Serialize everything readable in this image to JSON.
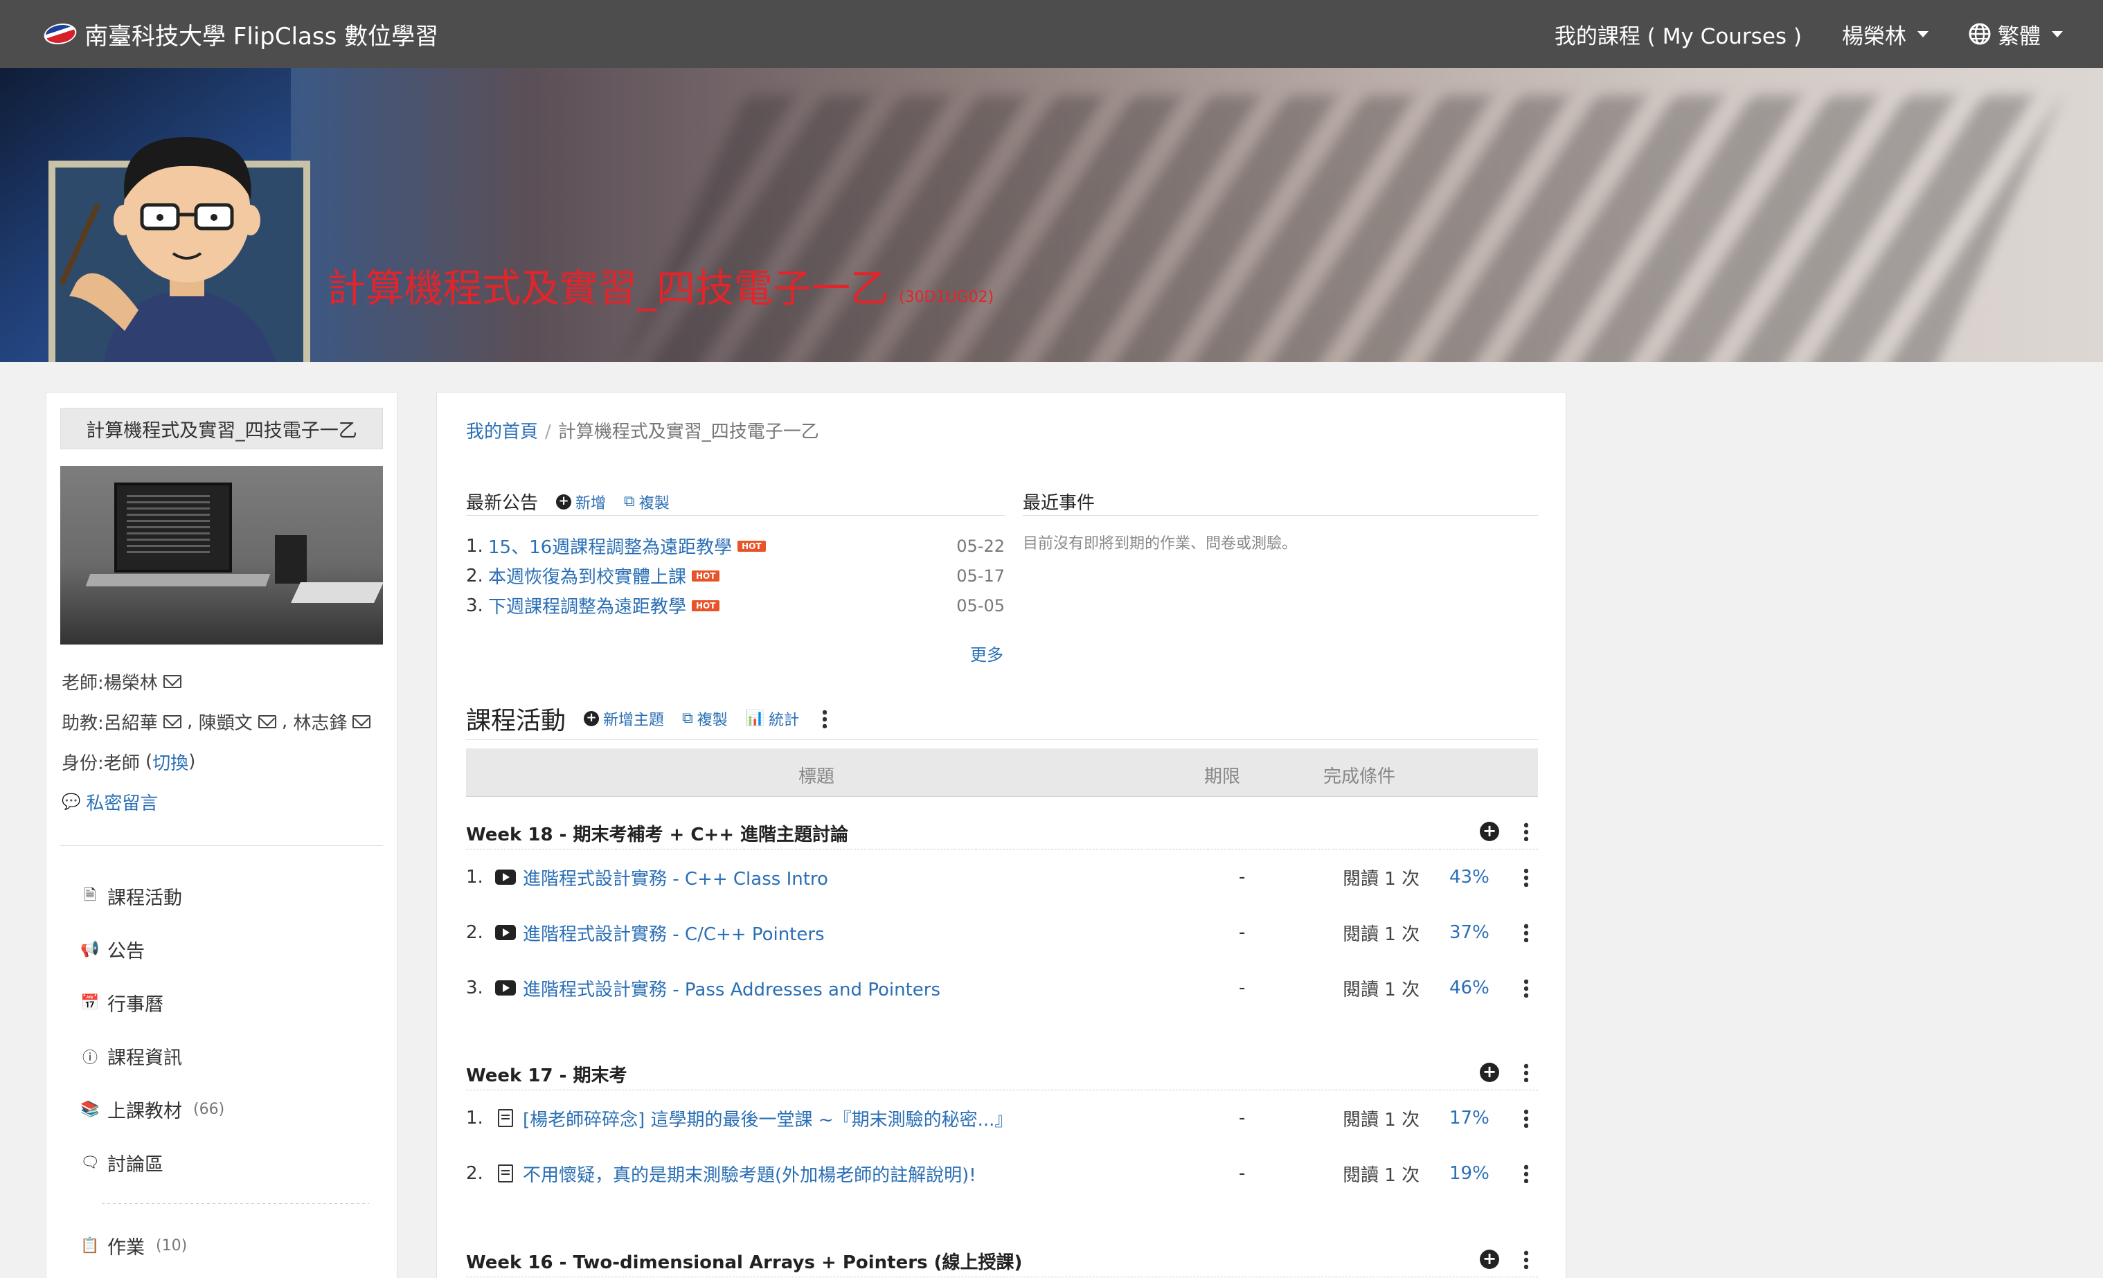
{
  "navbar": {
    "brand": "南臺科技大學 FlipClass 數位學習",
    "my_courses": "我的課程 ( My Courses )",
    "user": "楊榮林",
    "language": "繁體"
  },
  "banner": {
    "course_title": "計算機程式及實習_四技電子一乙",
    "course_code": "(30D1UG02)"
  },
  "sidebar": {
    "course_name": "計算機程式及實習_四技電子一乙",
    "teacher_label": "老師: ",
    "teacher_name": "楊榮林",
    "ta_label": "助教: ",
    "tas": [
      "呂紹華",
      "陳顗文",
      "林志鋒"
    ],
    "role_label": "身份: ",
    "role": "老師",
    "switch_label": "切換",
    "private_message": "私密留言",
    "menu": [
      {
        "label": "課程活動",
        "count": "",
        "icon": "file-icon"
      },
      {
        "label": "公告",
        "count": "",
        "icon": "megaphone-icon"
      },
      {
        "label": "行事曆",
        "count": "",
        "icon": "calendar-icon"
      },
      {
        "label": "課程資訊",
        "count": "",
        "icon": "info-icon"
      },
      {
        "label": "上課教材",
        "count": "(66)",
        "icon": "books-icon"
      },
      {
        "label": "討論區",
        "count": "",
        "icon": "chat-icon"
      },
      {
        "label": "作業",
        "count": "(10)",
        "icon": "clipboard-icon"
      }
    ]
  },
  "breadcrumb": {
    "home": "我的首頁",
    "current": "計算機程式及實習_四技電子一乙"
  },
  "announcements": {
    "title": "最新公告",
    "add": "新增",
    "copy": "複製",
    "items": [
      {
        "num": "1.",
        "text": "15、16週課程調整為遠距教學",
        "badge": "HOT",
        "date": "05-22"
      },
      {
        "num": "2.",
        "text": "本週恢復為到校實體上課",
        "badge": "HOT",
        "date": "05-17"
      },
      {
        "num": "3.",
        "text": "下週課程調整為遠距教學",
        "badge": "HOT",
        "date": "05-05"
      }
    ],
    "more": "更多"
  },
  "events": {
    "title": "最近事件",
    "empty": "目前沒有即將到期的作業、問卷或測驗。"
  },
  "activities": {
    "title": "課程活動",
    "add_topic": "新增主題",
    "copy": "複製",
    "stats": "統計",
    "columns": {
      "title": "標題",
      "deadline": "期限",
      "completion": "完成條件"
    },
    "topics": [
      {
        "title": "Week 18 - 期末考補考 + C++ 進階主題討論",
        "items": [
          {
            "num": "1.",
            "type": "video",
            "text": "進階程式設計實務 - C++ Class Intro",
            "deadline": "-",
            "cond": "閱讀 1 次",
            "pct": "43%"
          },
          {
            "num": "2.",
            "type": "video",
            "text": "進階程式設計實務 - C/C++ Pointers",
            "deadline": "-",
            "cond": "閱讀 1 次",
            "pct": "37%"
          },
          {
            "num": "3.",
            "type": "video",
            "text": "進階程式設計實務 - Pass Addresses and Pointers",
            "deadline": "-",
            "cond": "閱讀 1 次",
            "pct": "46%"
          }
        ]
      },
      {
        "title": "Week 17 - 期末考",
        "items": [
          {
            "num": "1.",
            "type": "doc",
            "text": "[楊老師碎碎念] 這學期的最後一堂課 ~『期末測驗的秘密...』",
            "deadline": "-",
            "cond": "閱讀 1 次",
            "pct": "17%"
          },
          {
            "num": "2.",
            "type": "doc",
            "text": "不用懷疑，真的是期末測驗考題(外加楊老師的註解說明)!",
            "deadline": "-",
            "cond": "閱讀 1 次",
            "pct": "19%"
          }
        ]
      },
      {
        "title": "Week 16 - Two-dimensional Arrays + Pointers (線上授課)",
        "items": []
      }
    ]
  }
}
